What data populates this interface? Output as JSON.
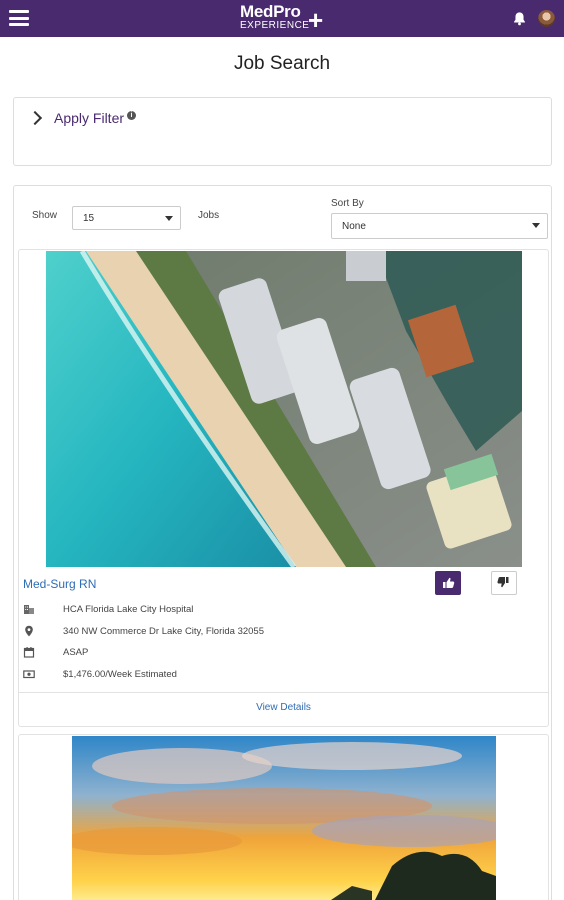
{
  "header": {
    "logo_main": "MedPro",
    "logo_sub": "EXPERIENCE",
    "logo_plus": "+"
  },
  "page": {
    "title": "Job Search"
  },
  "filter": {
    "label": "Apply Filter"
  },
  "controls": {
    "show_label": "Show",
    "show_value": "15",
    "jobs_label": "Jobs",
    "sort_label": "Sort By",
    "sort_value": "None"
  },
  "jobs": [
    {
      "title": "Med-Surg RN",
      "facility": "HCA Florida Lake City Hospital",
      "address": "340 NW Commerce Dr Lake City, Florida 32055",
      "start": "ASAP",
      "pay": "$1,476.00/Week Estimated",
      "view_label": "View Details",
      "image": "aerial-beach-towers"
    },
    {
      "image": "sunset-sky"
    }
  ],
  "colors": {
    "brand": "#4a2a6f",
    "link": "#2f6db5"
  }
}
